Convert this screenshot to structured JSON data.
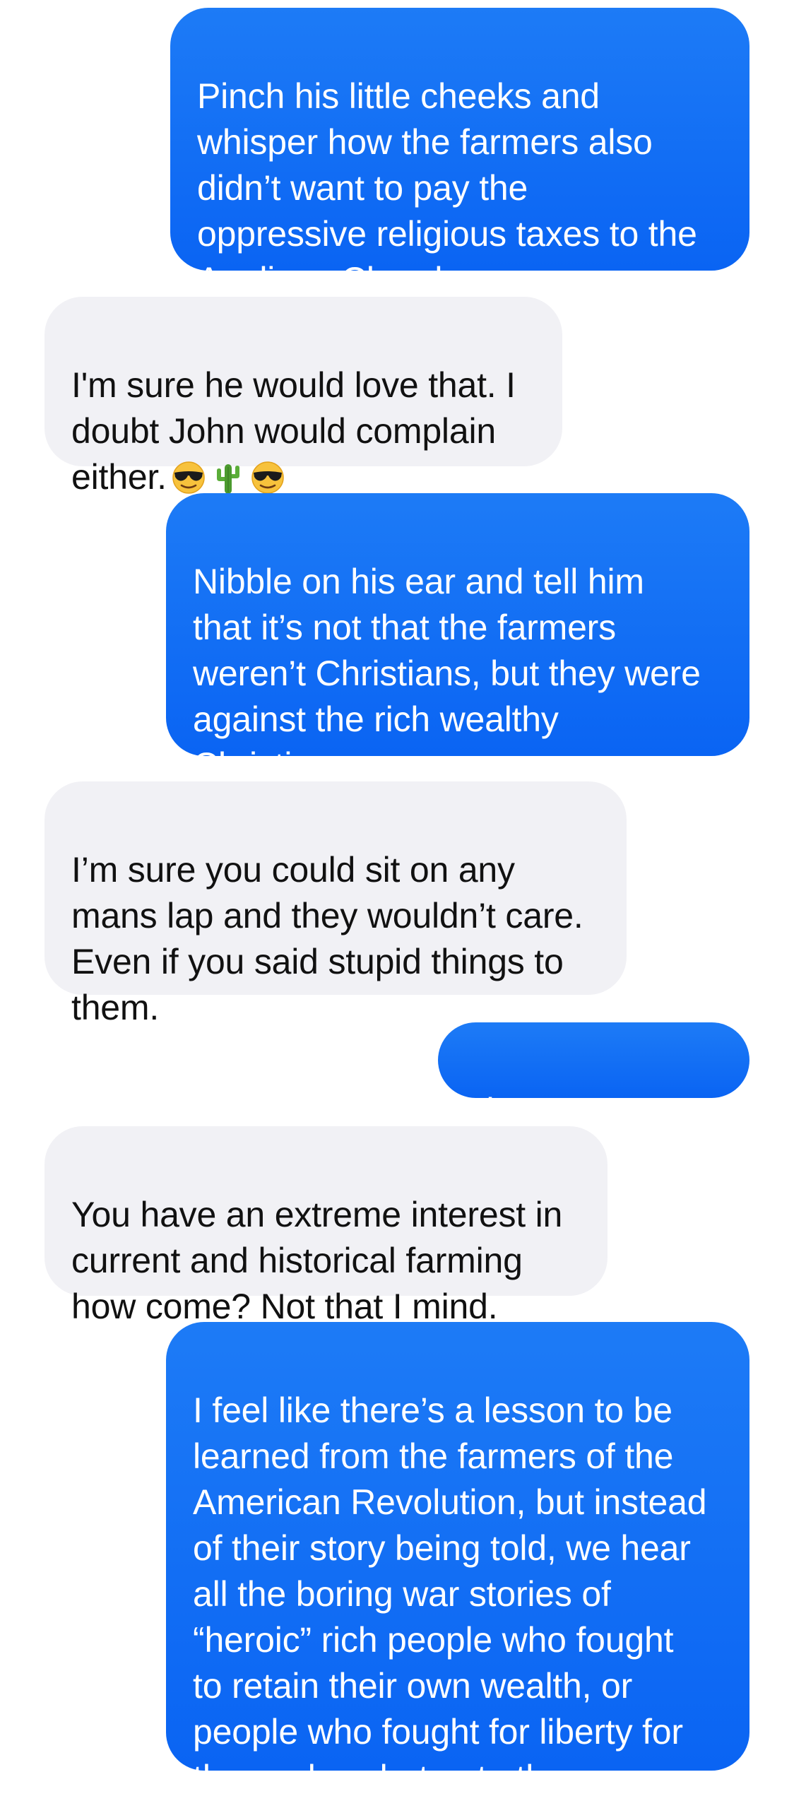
{
  "messages": [
    {
      "from": "me",
      "text": "Pinch his little cheeks and\nwhisper how the farmers also\ndidn’t want to pay the\noppressive religious taxes to the\nAnglican Church."
    },
    {
      "from": "them",
      "text": "I'm sure he would love that. I\ndoubt John  would complain\neither.",
      "emoji": [
        "smiling-face-with-sunglasses",
        "cactus",
        "smiling-face-with-sunglasses"
      ]
    },
    {
      "from": "me",
      "text": "Nibble on his ear and tell him\nthat it’s not that the farmers\nweren’t Christians, but they were\nagainst the rich wealthy\nChristians."
    },
    {
      "from": "them",
      "text": "I’m sure you could sit on any\nmans lap and they wouldn’t care.\nEven if you said stupid things to\nthem."
    },
    {
      "from": "me",
      "text": "That’s so sweet."
    },
    {
      "from": "them",
      "text": "You have an extreme interest in\ncurrent and historical farming\nhow come? Not that I mind."
    },
    {
      "from": "me",
      "text": "I feel like there’s a lesson to be\nlearned from the farmers of the\nAmerican Revolution, but instead\nof their story being told, we hear\nall the boring war stories of\n“heroic” rich people who fought\nto retain their own wealth, or\npeople who fought for liberty for\nthemselves but not others."
    }
  ],
  "colors": {
    "sent_bubble": "#0a64f3",
    "received_bubble": "#f1f1f5",
    "sent_text": "#ffffff",
    "received_text": "#111111"
  }
}
